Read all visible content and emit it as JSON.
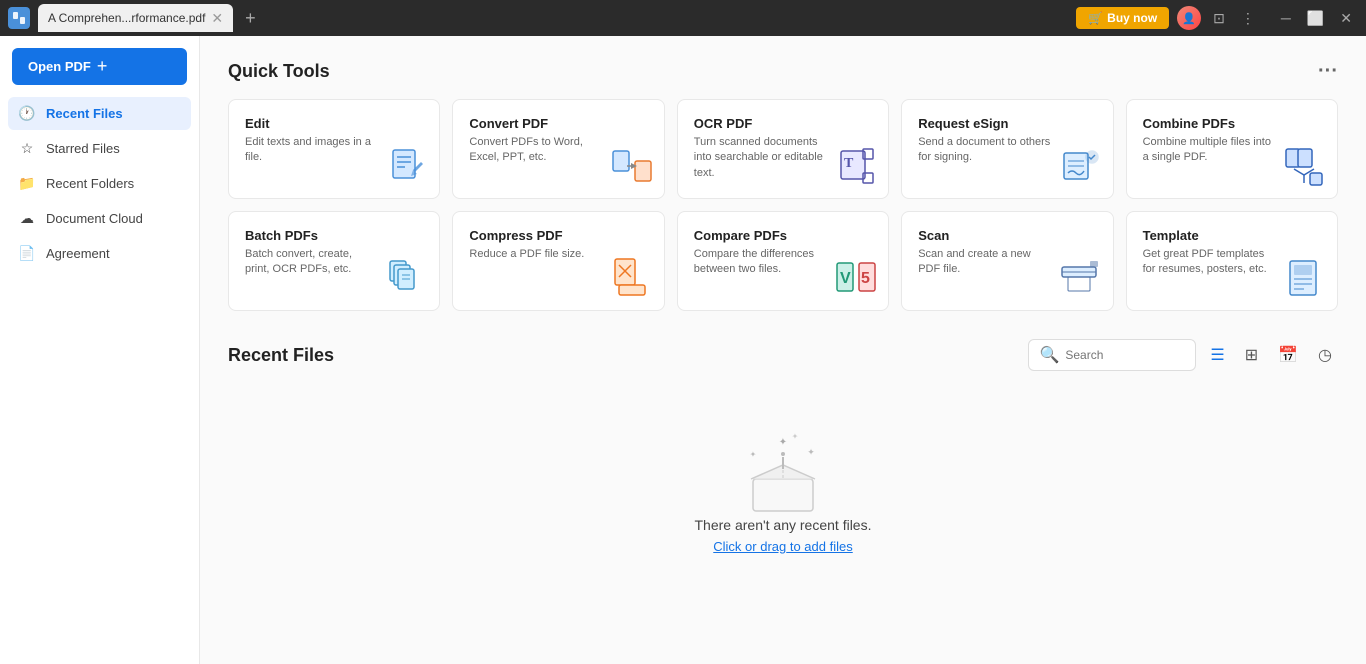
{
  "titlebar": {
    "logo_text": "F",
    "tab_title": "A  Comprehen...rformance.pdf",
    "buy_now_label": "Buy now",
    "add_tab_label": "+"
  },
  "sidebar": {
    "open_pdf_label": "Open PDF",
    "add_label": "+",
    "nav_items": [
      {
        "id": "recent-files",
        "label": "Recent Files",
        "icon": "🕐",
        "active": true
      },
      {
        "id": "starred-files",
        "label": "Starred Files",
        "icon": "☆",
        "active": false
      },
      {
        "id": "recent-folders",
        "label": "Recent Folders",
        "icon": "📁",
        "active": false
      },
      {
        "id": "document-cloud",
        "label": "Document Cloud",
        "icon": "☁",
        "active": false
      },
      {
        "id": "agreement",
        "label": "Agreement",
        "icon": "📄",
        "active": false
      }
    ]
  },
  "main": {
    "quick_tools_title": "Quick Tools",
    "recent_files_title": "Recent Files",
    "search_placeholder": "Search",
    "tools": [
      {
        "id": "edit",
        "title": "Edit",
        "desc": "Edit texts and images in a file.",
        "icon_type": "edit"
      },
      {
        "id": "convert-pdf",
        "title": "Convert PDF",
        "desc": "Convert PDFs to Word, Excel, PPT, etc.",
        "icon_type": "convert"
      },
      {
        "id": "ocr-pdf",
        "title": "OCR PDF",
        "desc": "Turn scanned documents into searchable or editable text.",
        "icon_type": "ocr"
      },
      {
        "id": "request-esign",
        "title": "Request eSign",
        "desc": "Send a document to others for signing.",
        "icon_type": "esign"
      },
      {
        "id": "combine-pdfs",
        "title": "Combine PDFs",
        "desc": "Combine multiple files into a single PDF.",
        "icon_type": "combine"
      },
      {
        "id": "batch-pdfs",
        "title": "Batch PDFs",
        "desc": "Batch convert, create, print, OCR PDFs, etc.",
        "icon_type": "batch"
      },
      {
        "id": "compress-pdf",
        "title": "Compress PDF",
        "desc": "Reduce a PDF file size.",
        "icon_type": "compress"
      },
      {
        "id": "compare-pdfs",
        "title": "Compare PDFs",
        "desc": "Compare the differences between two files.",
        "icon_type": "compare"
      },
      {
        "id": "scan",
        "title": "Scan",
        "desc": "Scan and create a new PDF file.",
        "icon_type": "scan"
      },
      {
        "id": "template",
        "title": "Template",
        "desc": "Get great PDF templates for resumes, posters, etc.",
        "icon_type": "template"
      }
    ],
    "empty_state": {
      "message": "There aren't any recent files.",
      "cta_link": "Click or drag",
      "cta_text": " to add files"
    }
  }
}
